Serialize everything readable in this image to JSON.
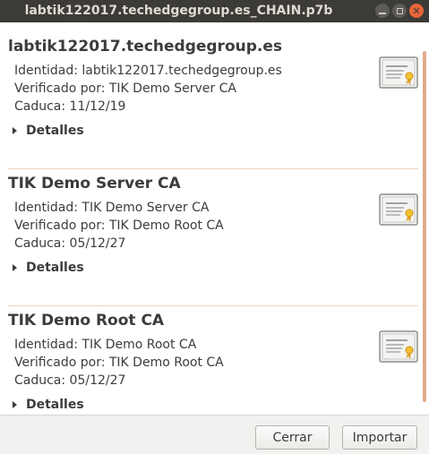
{
  "window": {
    "title": "labtik122017.techedgegroup.es_CHAIN.p7b"
  },
  "certificates": [
    {
      "name": "labtik122017.techedgegroup.es",
      "identity": "Identidad: labtik122017.techedgegroup.es",
      "verified_by": "Verificado por: TIK Demo Server CA",
      "expires": "Caduca: 11/12/19",
      "details_label": "Detalles",
      "icon": "certificate-icon"
    },
    {
      "name": "TIK Demo Server CA",
      "identity": "Identidad: TIK Demo Server CA",
      "verified_by": "Verificado por: TIK Demo Root CA",
      "expires": "Caduca: 05/12/27",
      "details_label": "Detalles",
      "icon": "certificate-icon"
    },
    {
      "name": "TIK Demo Root CA",
      "identity": "Identidad: TIK Demo Root CA",
      "verified_by": "Verificado por: TIK Demo Root CA",
      "expires": "Caduca: 05/12/27",
      "details_label": "Detalles",
      "icon": "certificate-icon"
    }
  ],
  "buttons": {
    "close_label": "Cerrar",
    "import_label": "Importar"
  },
  "colors": {
    "titlebar": "#3c3b37",
    "close": "#e9643a",
    "separator": "#f1d3c3",
    "scrollbar": "#e0aa8a"
  }
}
